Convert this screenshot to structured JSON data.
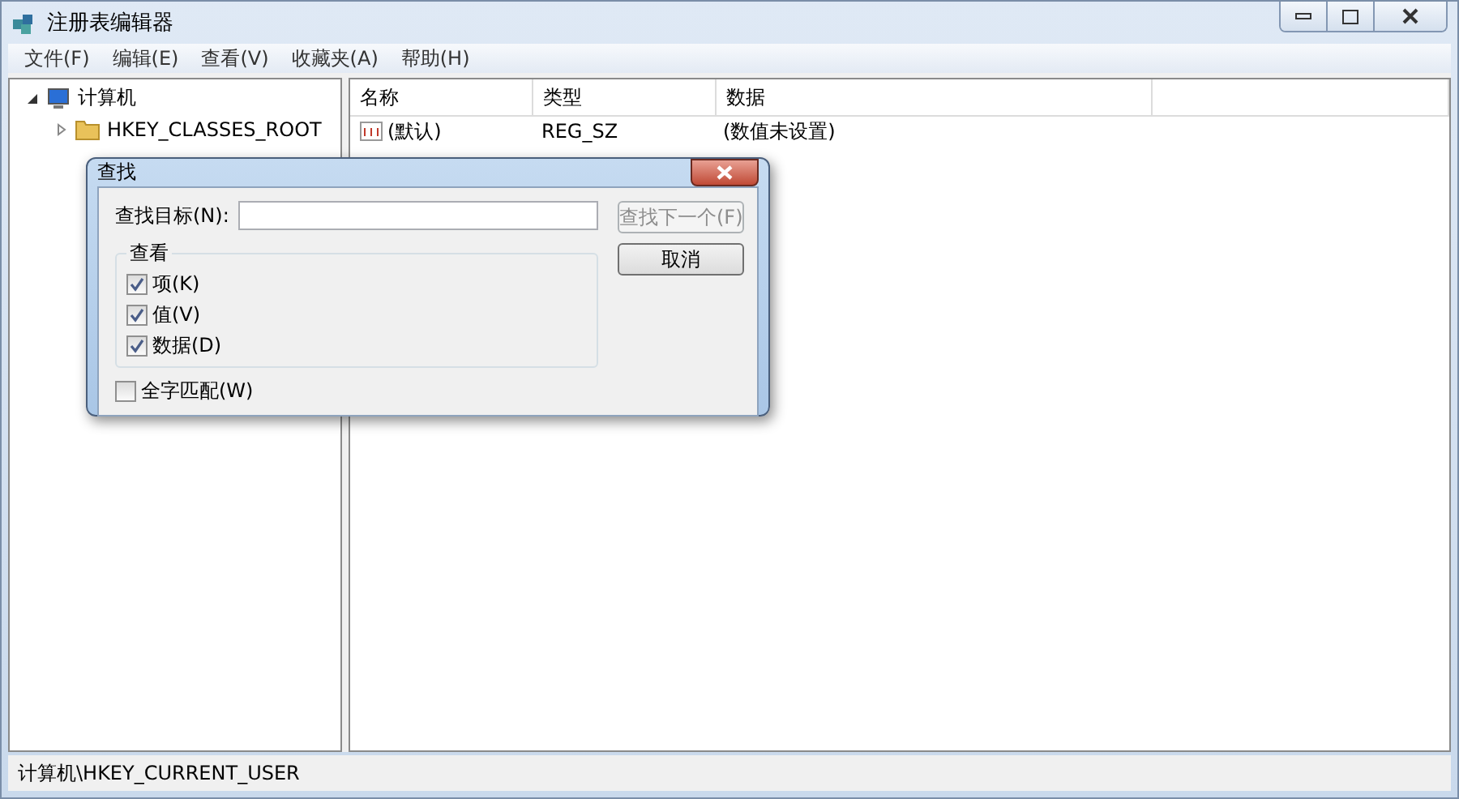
{
  "window": {
    "title": "注册表编辑器"
  },
  "menu": [
    "文件(F)",
    "编辑(E)",
    "查看(V)",
    "收藏夹(A)",
    "帮助(H)"
  ],
  "tree": {
    "name": "计算机",
    "expanded": true,
    "children": [
      {
        "name": "HKEY_CLASSES_ROOT",
        "expanded": false
      }
    ]
  },
  "table": {
    "columns": [
      "名称",
      "类型",
      "数据"
    ],
    "rows": [
      [
        "(默认)",
        "REG_SZ",
        "(数值未设置)"
      ]
    ]
  },
  "find_dialog": {
    "title": "查找",
    "label": "查找目标(N):",
    "buttons": [
      {
        "label": "查找下一个(F)",
        "disabled": true
      },
      {
        "label": "取消",
        "disabled": false
      }
    ],
    "group": "查看",
    "options": [
      {
        "label": "项(K)",
        "checked": true
      },
      {
        "label": "值(V)",
        "checked": true
      },
      {
        "label": "数据(D)",
        "checked": true
      }
    ],
    "whole_word": {
      "label": "全字匹配(W)",
      "checked": false
    }
  },
  "status_bar": "计算机\\HKEY_CURRENT_USER"
}
